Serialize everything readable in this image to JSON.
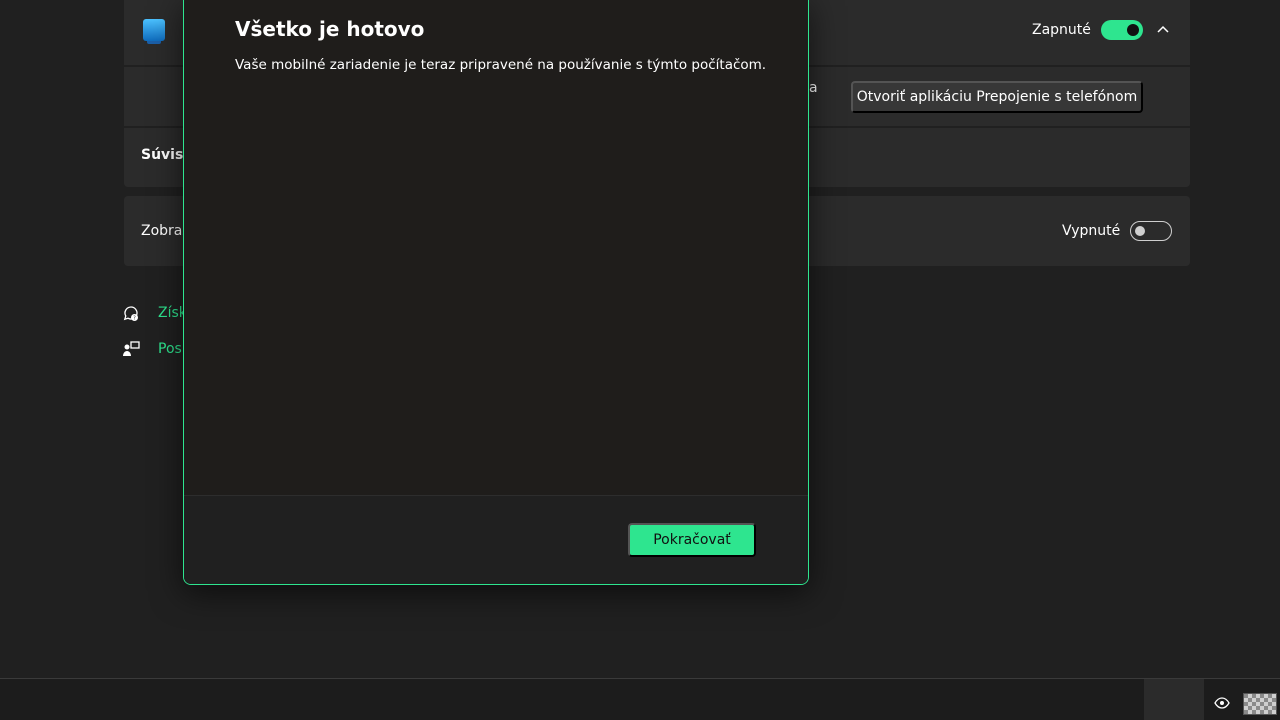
{
  "settings": {
    "phone_link_toggle_label": "Zapnuté",
    "open_app_button": "Otvoriť aplikáciu Prepojenie s telefónom",
    "subrow_fragment": "a",
    "related_fragment": "Súvisia",
    "show_fragment": "Zobraz",
    "show_toggle_label": "Vypnuté",
    "link1_fragment": "Získ",
    "link2_fragment": "Pos"
  },
  "dialog": {
    "title": "Všetko je hotovo",
    "message": "Vaše mobilné zariadenie je teraz pripravené na používanie s týmto počítačom.",
    "continue_button": "Pokračovať"
  },
  "colors": {
    "accent": "#2ee58f",
    "background": "#202020",
    "card": "#2b2b2b"
  },
  "icons": {
    "app": "phone-link-app-icon",
    "chevron": "chevron-up-icon",
    "help": "get-help-icon",
    "feedback": "give-feedback-icon",
    "tray": "eye-icon"
  }
}
